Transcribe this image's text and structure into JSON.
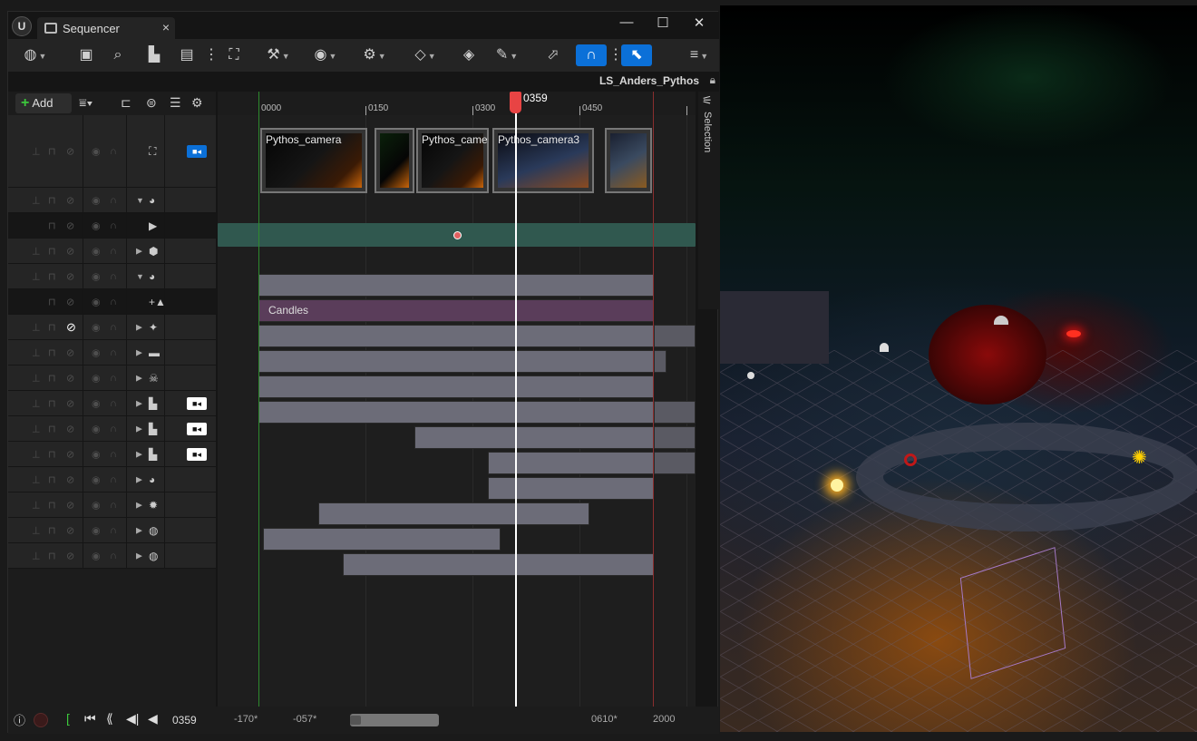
{
  "window": {
    "logo": "U",
    "tab_title": "Sequencer",
    "tab_close": "×",
    "minimize": "—",
    "maximize": "☐",
    "close": "✕"
  },
  "toolbar": {
    "icons": [
      "world-icon",
      "save-icon",
      "find-icon",
      "camera-icon",
      "clapper-icon",
      "more-icon",
      "render-icon",
      "key-wrench-icon",
      "eye-icon",
      "gear-icon",
      "key-diamond-icon",
      "key-add-icon",
      "pencil-icon",
      "select-icon",
      "snap-icon",
      "more-icon",
      "playhead-snap-icon",
      "menu-icon"
    ]
  },
  "sequence_name": "LS_Anders_Pythos",
  "left_panel": {
    "add_label": "Add",
    "rows": [
      {
        "icon": "camera-cut-icon",
        "camera": true,
        "camera_active": true,
        "tall": true
      },
      {
        "icon": "actor-icon",
        "expanded": true
      },
      {
        "icon": "play-icon",
        "dark": true,
        "sub": true
      },
      {
        "icon": "cube-icon"
      },
      {
        "icon": "actor-icon",
        "expanded": true
      },
      {
        "icon": "spawn-icon",
        "dark": true,
        "sub": true
      },
      {
        "icon": "fx-icon",
        "blocked": true
      },
      {
        "icon": "folder-icon"
      },
      {
        "icon": "skeleton-icon"
      },
      {
        "icon": "cine-camera-icon",
        "camera": true
      },
      {
        "icon": "cine-camera-icon",
        "camera": true
      },
      {
        "icon": "cine-camera-icon",
        "camera": true
      },
      {
        "icon": "actor-icon"
      },
      {
        "icon": "light-icon"
      },
      {
        "icon": "bulb-icon"
      },
      {
        "icon": "bulb-icon"
      }
    ]
  },
  "timeline": {
    "ruler_labels": [
      "0000",
      "0150",
      "0300",
      "0450"
    ],
    "playhead_frame": "0359",
    "camera_shots": [
      "Pythos_camera",
      "",
      "Pythos_came",
      "Pythos_camera3",
      ""
    ],
    "section_label": "Candles"
  },
  "selection_tab": "Selection",
  "bottom_bar": {
    "current_frame": "0359",
    "view_start": "-170*",
    "work_start": "-057*",
    "work_end": "0610*",
    "view_end": "2000"
  }
}
